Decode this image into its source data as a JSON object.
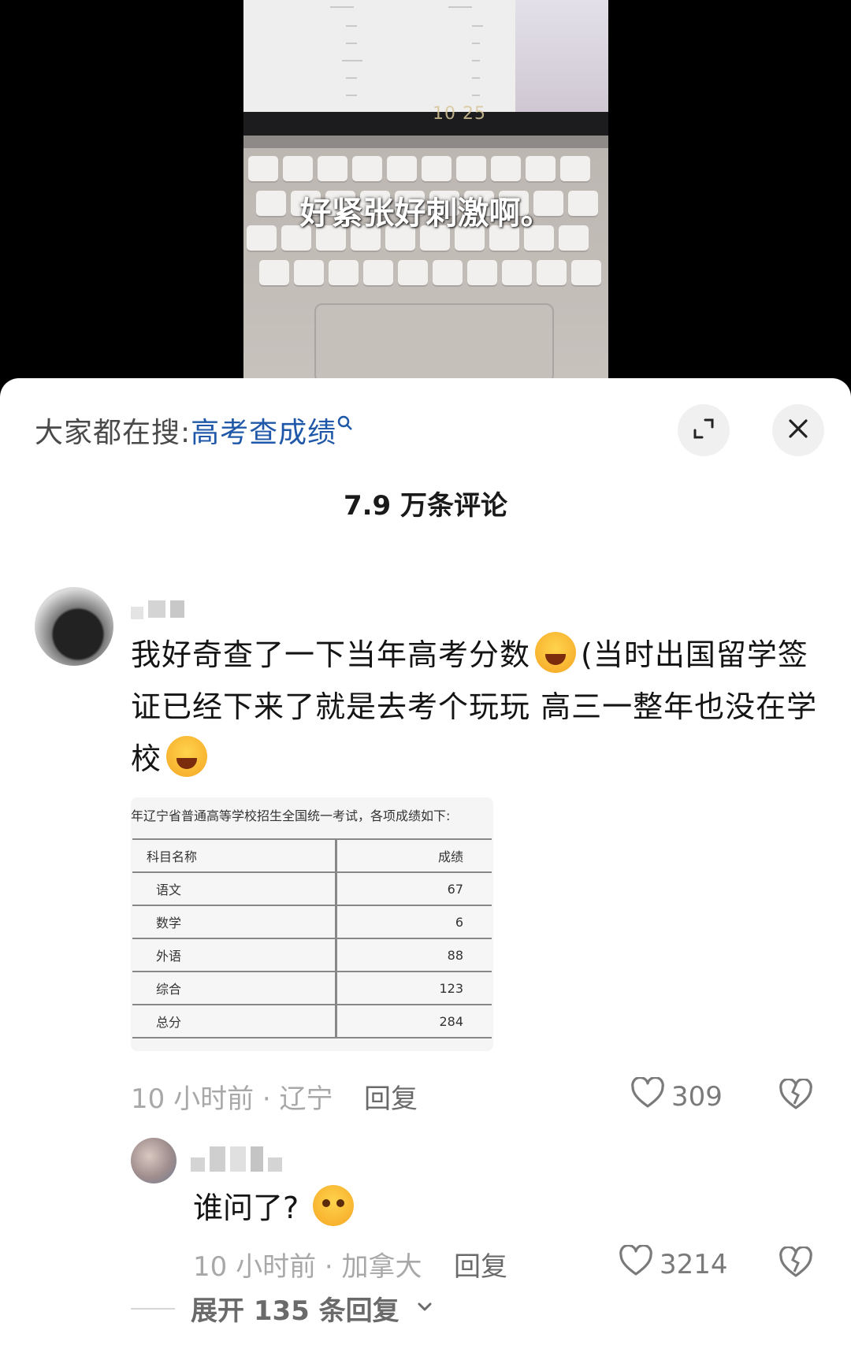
{
  "video": {
    "subtitle": "好紧张好刺激啊。",
    "screen_timestamp": "10 25"
  },
  "header": {
    "search_prefix": "大家都在搜:",
    "search_term": "高考查成绩",
    "expand_icon": "expand-icon",
    "close_icon": "close-icon"
  },
  "comments_count": "7.9 万条评论",
  "comment": {
    "text_part1": "我好奇查了一下当年高考分数",
    "text_part2": "(当时出国留学签证已经下来了就是去考个玩玩 高三一整年也没在学校",
    "image": {
      "title": "年辽宁省普通高等学校招生全国统一考试，各项成绩如下:",
      "header": [
        "科目名称",
        "成绩"
      ],
      "rows": [
        [
          "语文",
          "67"
        ],
        [
          "数学",
          "6"
        ],
        [
          "外语",
          "88"
        ],
        [
          "综合",
          "123"
        ],
        [
          "总分",
          "284"
        ]
      ]
    },
    "meta": "10 小时前 · 辽宁",
    "reply_label": "回复",
    "likes": "309"
  },
  "reply": {
    "text": "谁问了?",
    "meta": "10 小时前 · 加拿大",
    "reply_label": "回复",
    "likes": "3214"
  },
  "expand_replies": "展开 135 条回复"
}
